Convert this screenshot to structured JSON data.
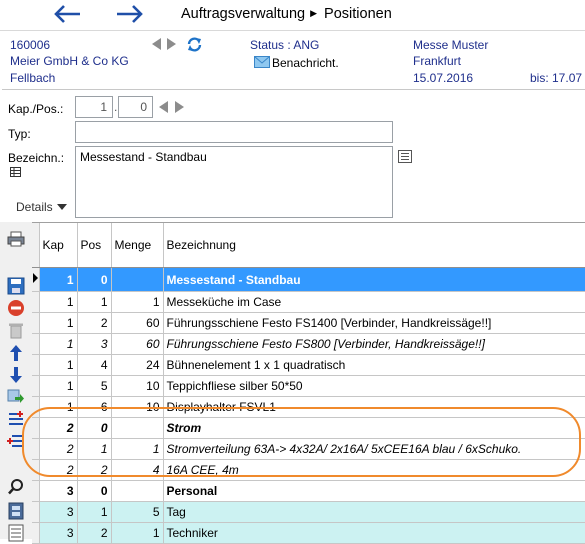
{
  "header_bar": {
    "breadcrumb_1": "Auftragsverwaltung",
    "breadcrumb_2": "Positionen"
  },
  "order": {
    "number": "160006",
    "customer": "Meier GmbH & Co KG",
    "city": "Fellbach",
    "status": "Status : ANG",
    "notify_label": "Benachricht.",
    "event": "Messe Muster",
    "event_city": "Frankfurt",
    "date_from": "15.07.2016",
    "date_to": "bis: 17.07"
  },
  "form": {
    "kap_pos_label": "Kap./Pos.:",
    "kap_value": "1",
    "pos_value": "0",
    "typ_label": "Typ:",
    "typ_value": "",
    "bezeichn_label": "Bezeichn.:",
    "bezeichn_value": "Messestand - Standbau",
    "details_label": "Details"
  },
  "table": {
    "columns": [
      "Kap",
      "Pos",
      "Menge",
      "Bezeichnung"
    ],
    "rows": [
      {
        "kap": "1",
        "pos": "0",
        "menge": "",
        "text": "Messestand - Standbau",
        "style": "selected"
      },
      {
        "kap": "1",
        "pos": "1",
        "menge": "1",
        "text": "Messeküche im Case",
        "style": "normal"
      },
      {
        "kap": "1",
        "pos": "2",
        "menge": "60",
        "text": "Führungsschiene Festo FS1400 [Verbinder, Handkreissäge!!]",
        "style": "normal"
      },
      {
        "kap": "1",
        "pos": "3",
        "menge": "60",
        "text": "Führungsschiene Festo FS800 [Verbinder, Handkreissäge!!]",
        "style": "italic"
      },
      {
        "kap": "1",
        "pos": "4",
        "menge": "24",
        "text": "Bühnenelement 1 x 1 quadratisch",
        "style": "normal"
      },
      {
        "kap": "1",
        "pos": "5",
        "menge": "10",
        "text": "Teppichfliese silber 50*50",
        "style": "normal"
      },
      {
        "kap": "1",
        "pos": "6",
        "menge": "10",
        "text": "Displayhalter FSVL1",
        "style": "normal"
      },
      {
        "kap": "2",
        "pos": "0",
        "menge": "",
        "text": "Strom",
        "style": "bold-italic"
      },
      {
        "kap": "2",
        "pos": "1",
        "menge": "1",
        "text": "Stromverteilung 63A-> 4x32A/ 2x16A/ 5xCEE16A blau / 6xSchuko.",
        "style": "italic"
      },
      {
        "kap": "2",
        "pos": "2",
        "menge": "4",
        "text": "16A CEE, 4m",
        "style": "italic"
      },
      {
        "kap": "3",
        "pos": "0",
        "menge": "",
        "text": "Personal",
        "style": "bold"
      },
      {
        "kap": "3",
        "pos": "1",
        "menge": "5",
        "text": "Tag",
        "style": "teal"
      },
      {
        "kap": "3",
        "pos": "2",
        "menge": "1",
        "text": "Techniker",
        "style": "teal"
      }
    ]
  },
  "colors": {
    "accent_text": "#1f2f8c",
    "selection": "#3399ff",
    "highlight_oval": "#f08a2c",
    "teal_row": "#ccf2f2"
  }
}
